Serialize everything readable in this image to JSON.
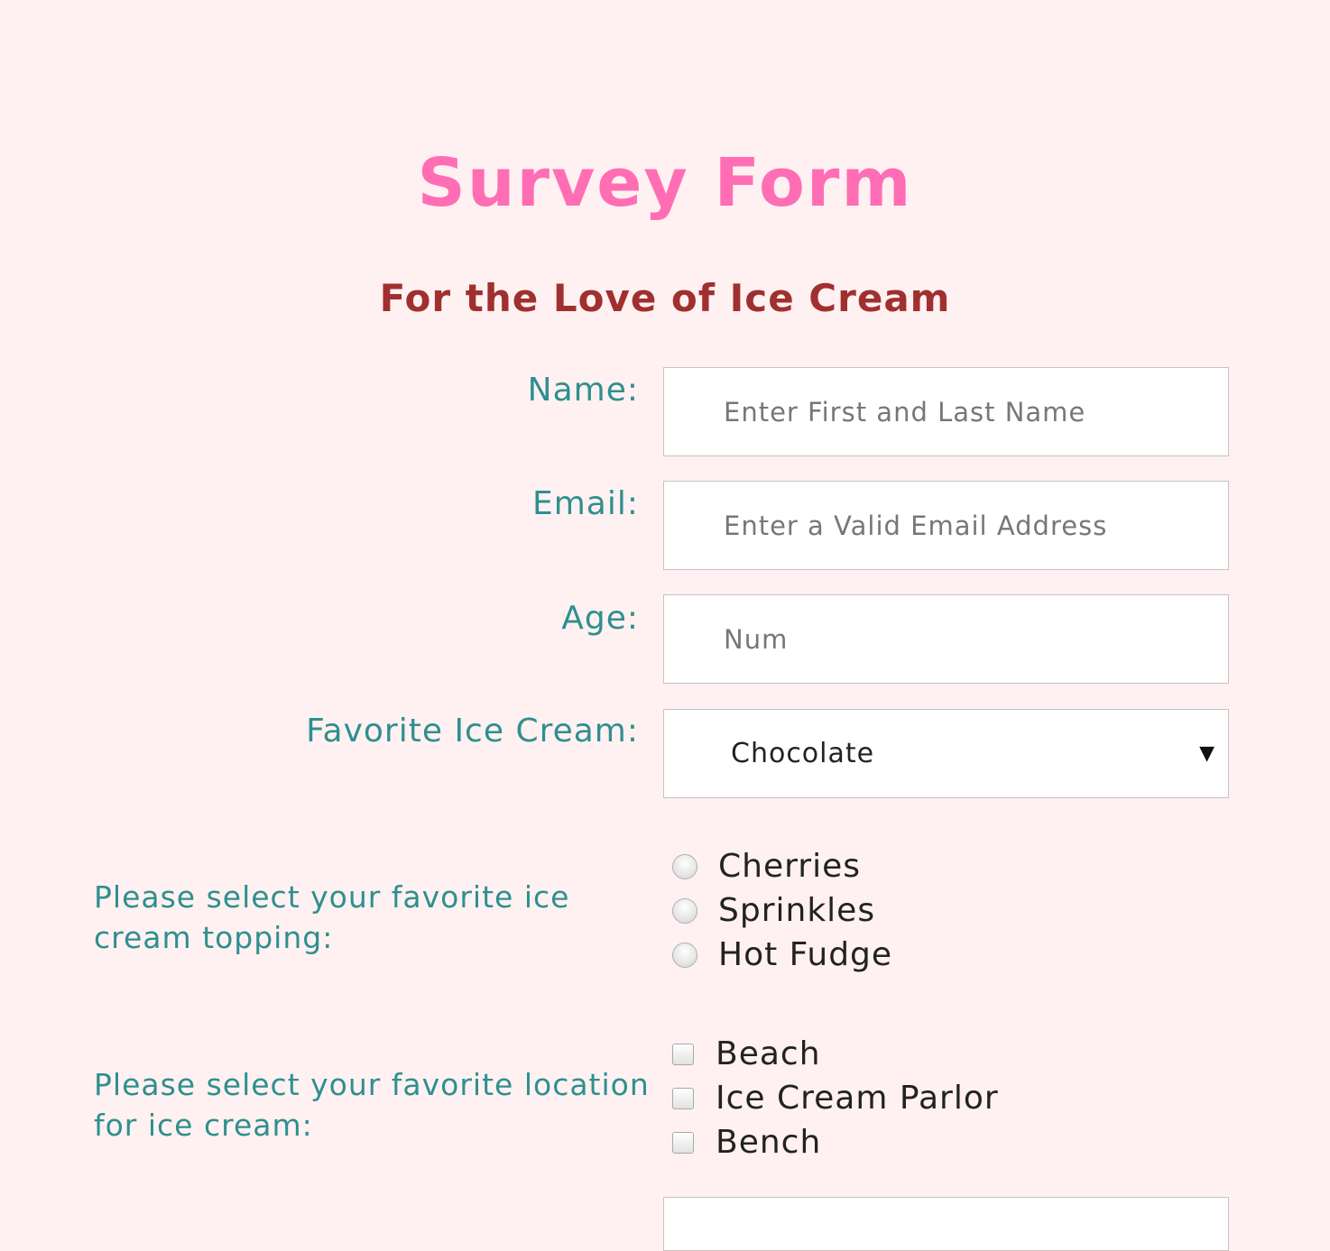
{
  "header": {
    "title": "Survey Form",
    "subtitle": "For the Love of Ice Cream"
  },
  "form": {
    "name": {
      "label": "Name:",
      "placeholder": "Enter First and Last Name"
    },
    "email": {
      "label": "Email:",
      "placeholder": "Enter a Valid Email Address"
    },
    "age": {
      "label": "Age:",
      "placeholder": "Num"
    },
    "favorite": {
      "label": "Favorite Ice Cream:",
      "selected": "Chocolate"
    },
    "topping": {
      "label": "Please select your favorite ice cream topping:",
      "options": [
        "Cherries",
        "Sprinkles",
        "Hot Fudge"
      ]
    },
    "location": {
      "label": "Please select your favorite location for ice cream:",
      "options": [
        "Beach",
        "Ice Cream Parlor",
        "Bench"
      ]
    }
  },
  "colors": {
    "background": "#fff1f1",
    "title": "#ff6eb4",
    "subtitle": "#a0302f",
    "label": "#2f8f8f"
  },
  "icons": {
    "select_arrow": "caret-down-icon"
  }
}
